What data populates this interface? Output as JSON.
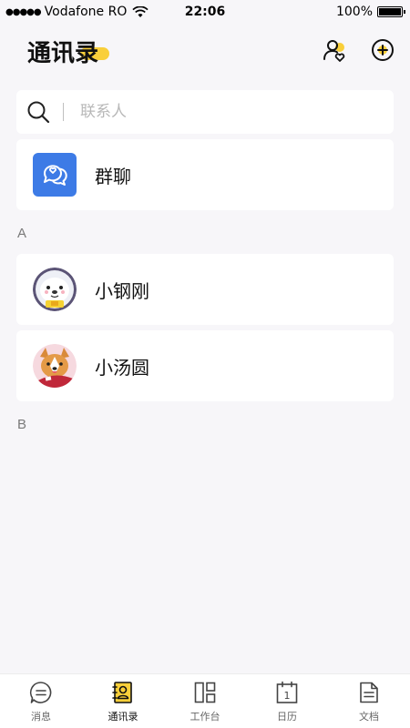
{
  "status_bar": {
    "carrier": "Vodafone RO",
    "time": "22:06",
    "battery": "100%"
  },
  "header": {
    "title": "通讯录",
    "accent_color": "#f9cf3a"
  },
  "search": {
    "placeholder": "联系人"
  },
  "group_chat": {
    "label": "群聊",
    "icon": "chat-bubbles-heart-icon",
    "color": "#3d7be6"
  },
  "sections": [
    {
      "letter": "A",
      "contacts": [
        {
          "name": "小钢刚",
          "avatar": "seal-avatar"
        },
        {
          "name": "小汤圆",
          "avatar": "corgi-avatar"
        }
      ]
    },
    {
      "letter": "B",
      "contacts": []
    }
  ],
  "tabs": [
    {
      "label": "消息",
      "icon": "message-icon",
      "active": false
    },
    {
      "label": "通讯录",
      "icon": "contacts-icon",
      "active": true
    },
    {
      "label": "工作台",
      "icon": "workbench-icon",
      "active": false
    },
    {
      "label": "日历",
      "icon": "calendar-icon",
      "active": false,
      "day": "1"
    },
    {
      "label": "文档",
      "icon": "document-icon",
      "active": false
    }
  ]
}
